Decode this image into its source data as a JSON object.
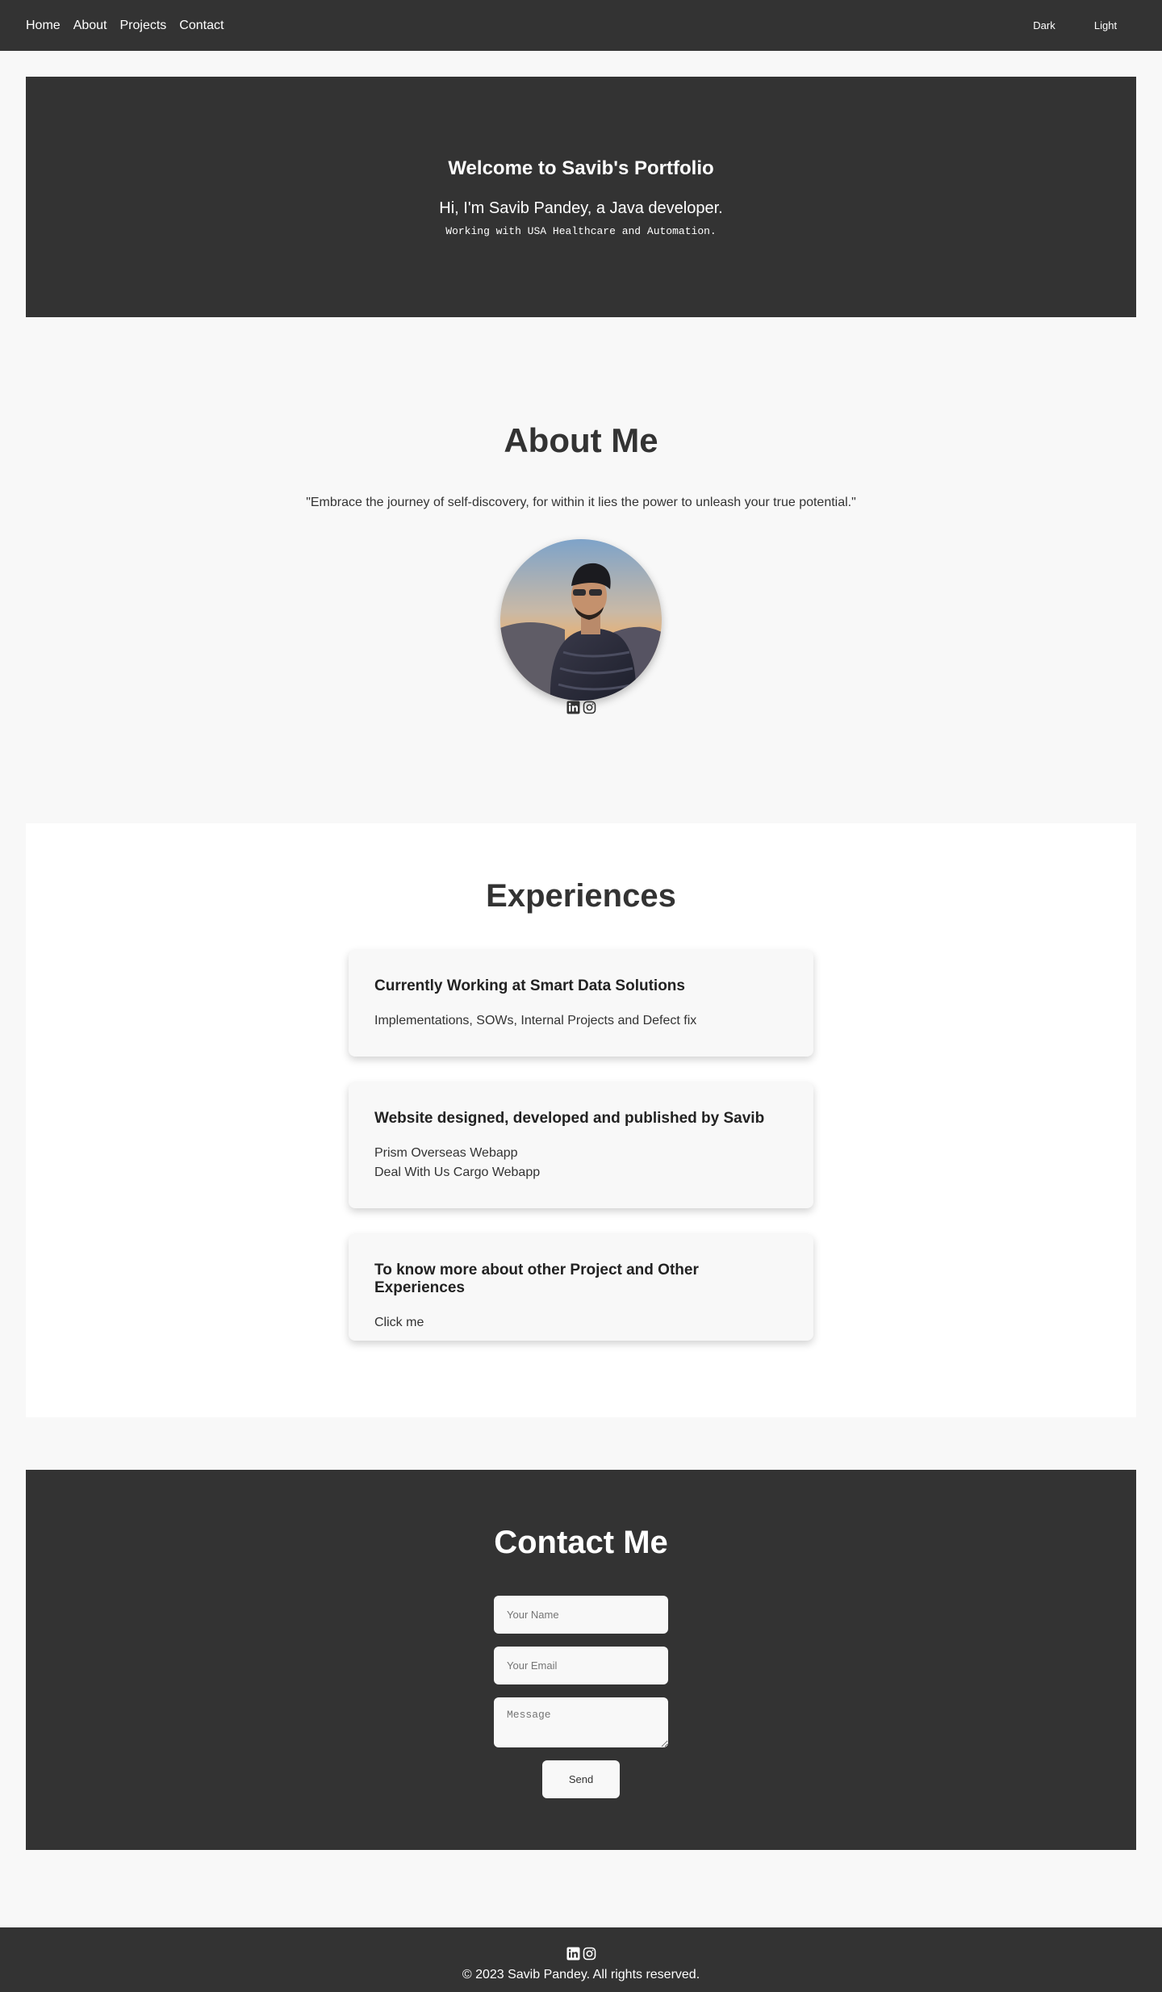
{
  "nav": {
    "links": [
      "Home",
      "About",
      "Projects",
      "Contact"
    ],
    "theme_dark": "Dark",
    "theme_light": "Light"
  },
  "hero": {
    "title": "Welcome to Savib's Portfolio",
    "subtitle": "Hi, I'm Savib Pandey, a Java developer.",
    "tagline": "Working with USA Healthcare and Automation."
  },
  "about": {
    "title": "About Me",
    "quote": "\"Embrace the journey of self-discovery, for within it lies the power to unleash your true potential.\"",
    "socials": [
      "linkedin-icon",
      "instagram-icon"
    ]
  },
  "experiences": {
    "title": "Experiences",
    "cards": [
      {
        "heading": "Currently Working at Smart Data Solutions",
        "lines": [
          "Implementations, SOWs, Internal Projects and Defect fix"
        ]
      },
      {
        "heading": "Website designed, developed and published by Savib",
        "lines": [
          "Prism Overseas Webapp",
          "Deal With Us Cargo Webapp"
        ]
      },
      {
        "heading": "To know more about other Project and Other Experiences",
        "lines": [
          "Click me"
        ]
      }
    ]
  },
  "contact": {
    "title": "Contact Me",
    "name_placeholder": "Your Name",
    "email_placeholder": "Your Email",
    "message_placeholder": "Message",
    "send_label": "Send"
  },
  "footer": {
    "copyright": "© 2023 Savib Pandey. All rights reserved.",
    "socials": [
      "linkedin-icon",
      "instagram-icon"
    ]
  },
  "colors": {
    "dark": "#333333",
    "background": "#f8f8f8",
    "white": "#ffffff"
  }
}
